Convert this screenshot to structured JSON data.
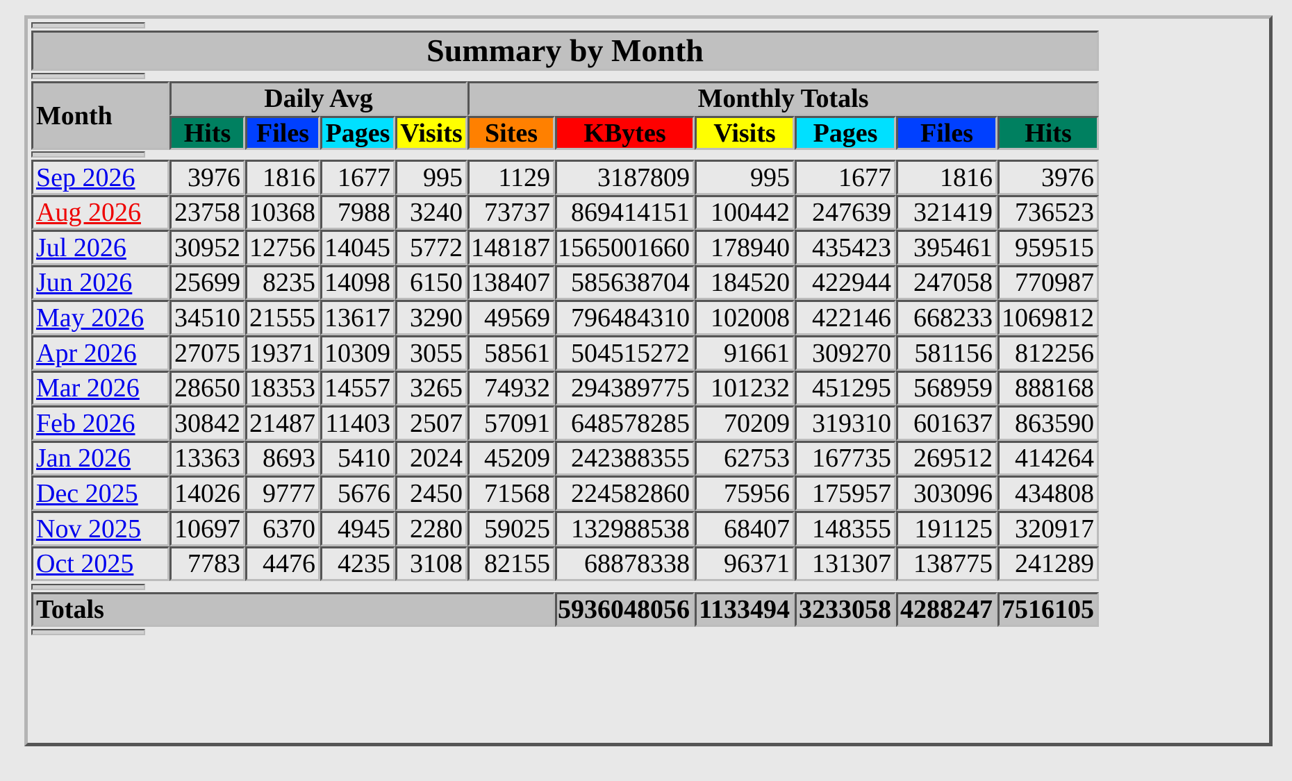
{
  "title": "Summary by Month",
  "header": {
    "month": "Month",
    "daily_avg": "Daily Avg",
    "monthly_totals": "Monthly Totals",
    "columns": [
      {
        "label": "Hits",
        "color": "#008060",
        "group": "daily"
      },
      {
        "label": "Files",
        "color": "#0040ff",
        "group": "daily"
      },
      {
        "label": "Pages",
        "color": "#00e0ff",
        "group": "daily"
      },
      {
        "label": "Visits",
        "color": "#ffff00",
        "group": "daily"
      },
      {
        "label": "Sites",
        "color": "#ff8000",
        "group": "monthly"
      },
      {
        "label": "KBytes",
        "color": "#ff0000",
        "group": "monthly"
      },
      {
        "label": "Visits",
        "color": "#ffff00",
        "group": "monthly"
      },
      {
        "label": "Pages",
        "color": "#00e0ff",
        "group": "monthly"
      },
      {
        "label": "Files",
        "color": "#0040ff",
        "group": "monthly"
      },
      {
        "label": "Hits",
        "color": "#008060",
        "group": "monthly"
      }
    ]
  },
  "rows": [
    {
      "month": "Sep 2026",
      "active": false,
      "values": [
        "3976",
        "1816",
        "1677",
        "995",
        "1129",
        "3187809",
        "995",
        "1677",
        "1816",
        "3976"
      ]
    },
    {
      "month": "Aug 2026",
      "active": true,
      "values": [
        "23758",
        "10368",
        "7988",
        "3240",
        "73737",
        "869414151",
        "100442",
        "247639",
        "321419",
        "736523"
      ]
    },
    {
      "month": "Jul 2026",
      "active": false,
      "values": [
        "30952",
        "12756",
        "14045",
        "5772",
        "148187",
        "1565001660",
        "178940",
        "435423",
        "395461",
        "959515"
      ]
    },
    {
      "month": "Jun 2026",
      "active": false,
      "values": [
        "25699",
        "8235",
        "14098",
        "6150",
        "138407",
        "585638704",
        "184520",
        "422944",
        "247058",
        "770987"
      ]
    },
    {
      "month": "May 2026",
      "active": false,
      "values": [
        "34510",
        "21555",
        "13617",
        "3290",
        "49569",
        "796484310",
        "102008",
        "422146",
        "668233",
        "1069812"
      ]
    },
    {
      "month": "Apr 2026",
      "active": false,
      "values": [
        "27075",
        "19371",
        "10309",
        "3055",
        "58561",
        "504515272",
        "91661",
        "309270",
        "581156",
        "812256"
      ]
    },
    {
      "month": "Mar 2026",
      "active": false,
      "values": [
        "28650",
        "18353",
        "14557",
        "3265",
        "74932",
        "294389775",
        "101232",
        "451295",
        "568959",
        "888168"
      ]
    },
    {
      "month": "Feb 2026",
      "active": false,
      "values": [
        "30842",
        "21487",
        "11403",
        "2507",
        "57091",
        "648578285",
        "70209",
        "319310",
        "601637",
        "863590"
      ]
    },
    {
      "month": "Jan 2026",
      "active": false,
      "values": [
        "13363",
        "8693",
        "5410",
        "2024",
        "45209",
        "242388355",
        "62753",
        "167735",
        "269512",
        "414264"
      ]
    },
    {
      "month": "Dec 2025",
      "active": false,
      "values": [
        "14026",
        "9777",
        "5676",
        "2450",
        "71568",
        "224582860",
        "75956",
        "175957",
        "303096",
        "434808"
      ]
    },
    {
      "month": "Nov 2025",
      "active": false,
      "values": [
        "10697",
        "6370",
        "4945",
        "2280",
        "59025",
        "132988538",
        "68407",
        "148355",
        "191125",
        "320917"
      ]
    },
    {
      "month": "Oct 2025",
      "active": false,
      "values": [
        "7783",
        "4476",
        "4235",
        "3108",
        "82155",
        "68878338",
        "96371",
        "131307",
        "138775",
        "241289"
      ]
    }
  ],
  "totals": {
    "label": "Totals",
    "values": [
      "5936048056",
      "1133494",
      "3233058",
      "4288247",
      "7516105"
    ]
  }
}
